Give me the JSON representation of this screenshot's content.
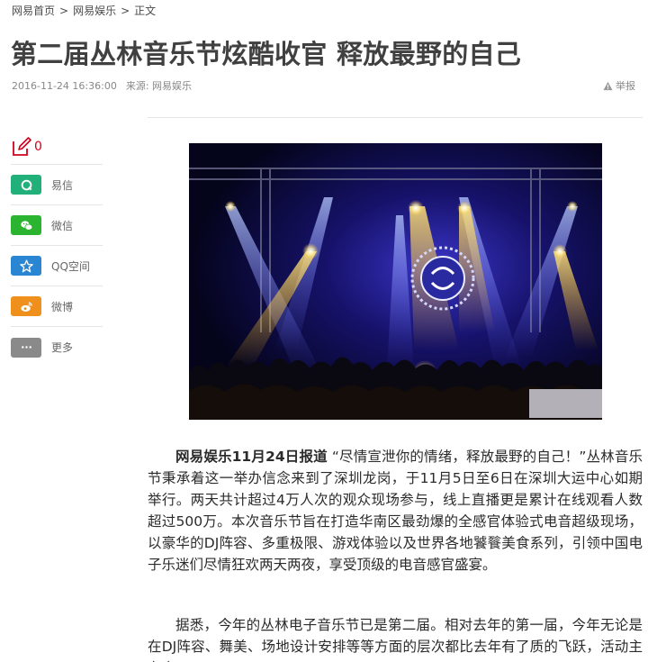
{
  "breadcrumb": {
    "home": "网易首页",
    "section": "网易娱乐",
    "current": "正文",
    "separator": ">"
  },
  "article": {
    "title": "第二届丛林音乐节炫酷收官 释放最野的自己",
    "date": "2016-11-24 16:36:00",
    "source": "来源: 网易娱乐",
    "report_label": "举报",
    "lead_bold": "网易娱乐11月24日报道",
    "paragraph1": "“尽情宣泄你的情绪，释放最野的自己！”丛林音乐节秉承着这一举办信念来到了深圳龙岗，于11月5日至6日在深圳大运中心如期举行。两天共计超过4万人次的观众现场参与，线上直播更是累计在线观看人数超过500万。本次音乐节旨在打造华南区最劲爆的全感官体验式电音超级现场，以豪华的DJ阵容、多重极限、游戏体验以及世界各地饕餮美食系列，引领中国电子乐迷们尽情狂欢两天两夜，享受顶级的电音感官盛宴。",
    "paragraph2": "据悉，今年的丛林电子音乐节已是第二届。相对去年的第一届，今年无论是在DJ阵容、舞美、场地设计安排等等方面的层次都比去年有了质的飞跃，活动主办方"
  },
  "share": {
    "comment_count": "0",
    "items": [
      {
        "label": "易信",
        "icon": "yixin-icon",
        "color": "#21b07a"
      },
      {
        "label": "微信",
        "icon": "wechat-icon",
        "color": "#2bb42f"
      },
      {
        "label": "QQ空间",
        "icon": "qzone-icon",
        "color": "#2a86d3"
      },
      {
        "label": "微博",
        "icon": "weibo-icon",
        "color": "#ef8f1c"
      },
      {
        "label": "更多",
        "icon": "more-icon",
        "color": "#8a8a8a"
      }
    ]
  },
  "colors": {
    "accent_red": "#d0021b",
    "divider": "#e5e5e5",
    "title": "#404040"
  }
}
